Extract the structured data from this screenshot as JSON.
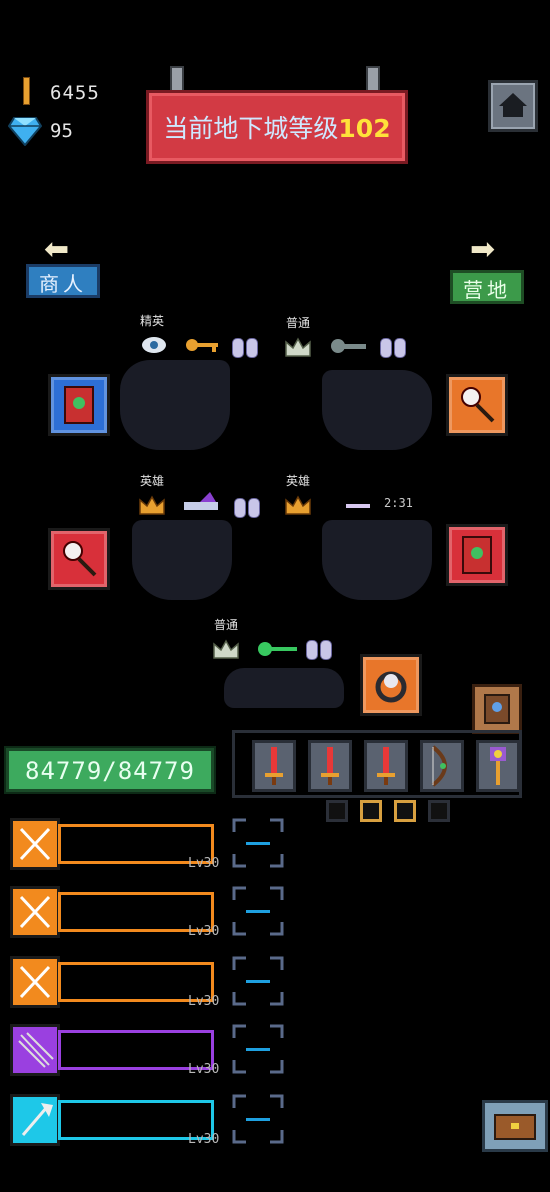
{
  "currency": {
    "gold": "6455",
    "gems": "95"
  },
  "banner": {
    "prefix": "当前地下城等级",
    "level": "102"
  },
  "nav": {
    "left_label": "商人",
    "right_label": "营地"
  },
  "dungeons": [
    {
      "tier": "精英"
    },
    {
      "tier": "普通"
    },
    {
      "tier": "英雄"
    },
    {
      "tier": "英雄",
      "timer": "2:31"
    },
    {
      "tier": "普通"
    }
  ],
  "player": {
    "hp": "84779/84779"
  },
  "heroes": [
    {
      "level": "Lv30",
      "color": "#f28a1e"
    },
    {
      "level": "Lv30",
      "color": "#f28a1e"
    },
    {
      "level": "Lv30",
      "color": "#f28a1e"
    },
    {
      "level": "Lv30",
      "color": "#9a40e0"
    },
    {
      "level": "Lv30",
      "color": "#1ec8e8"
    }
  ]
}
